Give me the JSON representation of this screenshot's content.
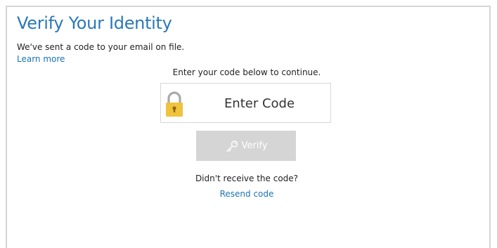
{
  "header": {
    "title": "Verify Your Identity"
  },
  "intro": {
    "message": "We've sent a code to your email on file.",
    "learn_more_label": "Learn more"
  },
  "form": {
    "instruction": "Enter your code below to continue.",
    "code_placeholder": "Enter Code",
    "code_value": "",
    "lock_icon": "lock-icon",
    "verify_label": "Verify",
    "verify_icon": "key-icon",
    "verify_enabled": false
  },
  "resend": {
    "prompt": "Didn't receive the code?",
    "link_label": "Resend code"
  },
  "colors": {
    "title": "#2a78b8",
    "link": "#1b74b5",
    "lock_body": "#f0c33c",
    "button_disabled": "#d5d5d5",
    "border": "#d4d4d4"
  }
}
